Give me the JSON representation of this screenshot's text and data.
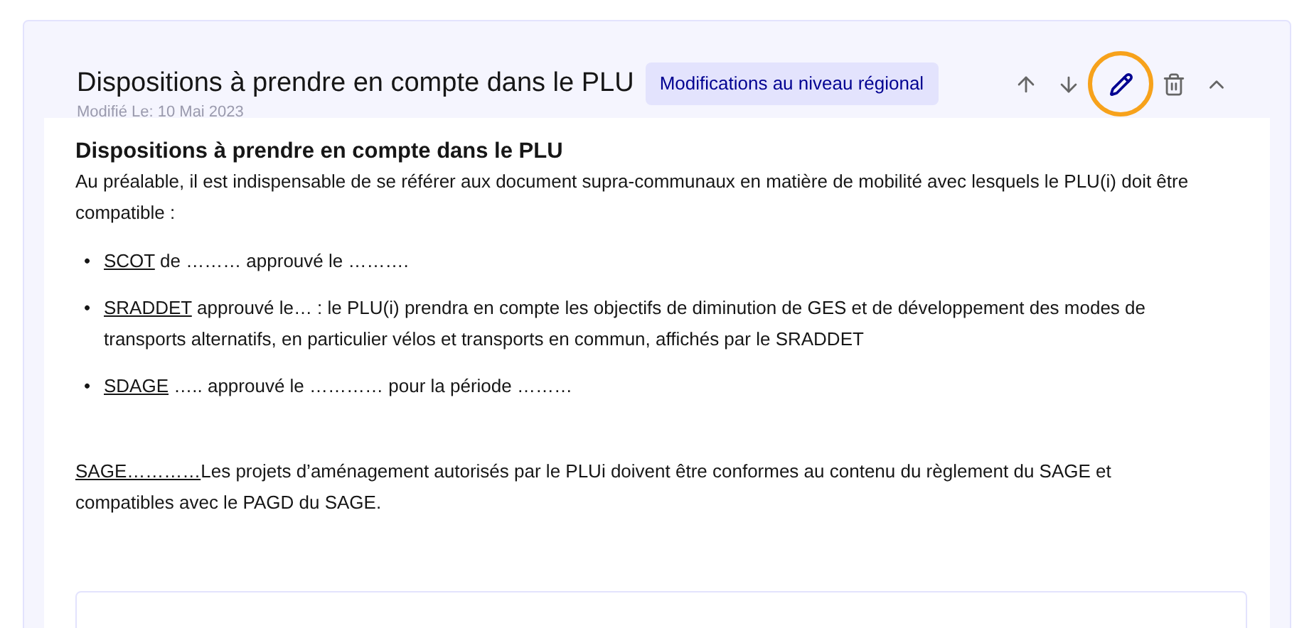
{
  "card": {
    "title": "Dispositions à prendre en compte dans le PLU",
    "tag": "Modifications au niveau régional",
    "modified": "Modifié Le: 10 Mai 2023",
    "actions": [
      {
        "kind": "up",
        "highlighted": false
      },
      {
        "kind": "down",
        "highlighted": false
      },
      {
        "kind": "edit",
        "highlighted": true
      },
      {
        "kind": "delete",
        "highlighted": false
      },
      {
        "kind": "collapse",
        "highlighted": false
      }
    ]
  },
  "content": {
    "heading": "Dispositions à prendre en compte dans le PLU",
    "intro": "Au préalable, il est indispensable de se référer aux document supra-communaux en matière de mobilité avec lesquels le PLU(i) doit être compatible :",
    "bullets": [
      {
        "marker": "•",
        "term": "SCOT",
        "text": " de ……… approuvé le ………."
      },
      {
        "marker": "•",
        "term": "SRADDET",
        "text": " approuvé le… : le PLU(i) prendra en compte les objectifs de diminution de GES et de développement des modes de transports alternatifs, en particulier vélos et transports en commun, affichés par le SRADDET"
      },
      {
        "marker": "•",
        "term": "SDAGE",
        "text": " ….. approuvé le ………… pour la période ………"
      }
    ],
    "paragraph": {
      "term": "SAGE…………",
      "text": "Les projets d’aménagement autorisés par le PLUi doivent être conformes au contenu du règlement du SAGE et compatibles avec le PAGD du SAGE."
    }
  }
}
